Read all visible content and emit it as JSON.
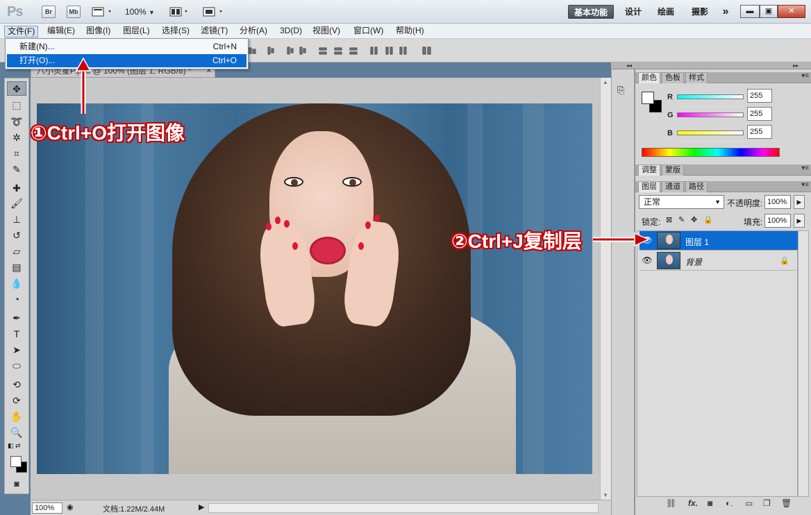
{
  "titlebar": {
    "logo": "Ps",
    "bridge": "Br",
    "minibridge": "Mb",
    "zoom": "100%",
    "workspaces": [
      "基本功能",
      "设计",
      "绘画",
      "摄影"
    ],
    "more": "»"
  },
  "menubar": {
    "items": [
      "文件(F)",
      "编辑(E)",
      "图像(I)",
      "图层(L)",
      "选择(S)",
      "滤镜(T)",
      "分析(A)",
      "3D(D)",
      "视图(V)",
      "窗口(W)",
      "帮助(H)"
    ]
  },
  "file_menu": {
    "items": [
      {
        "label": "新建(N)...",
        "shortcut": "Ctrl+N"
      },
      {
        "label": "打开(O)...",
        "shortcut": "Ctrl+O"
      }
    ]
  },
  "document": {
    "tab_title": "八小灵星P.psd @ 100% (图层 1, RGB/8) *"
  },
  "statusbar": {
    "zoom": "100%",
    "doc_info": "文档:1.22M/2.44M"
  },
  "color_panel": {
    "tabs": [
      "颜色",
      "色板",
      "样式"
    ],
    "channels": [
      {
        "label": "R",
        "value": "255"
      },
      {
        "label": "G",
        "value": "255"
      },
      {
        "label": "B",
        "value": "255"
      }
    ]
  },
  "adjust_panel": {
    "tabs": [
      "调整",
      "蒙版"
    ]
  },
  "layers_panel": {
    "tabs": [
      "图层",
      "通道",
      "路径"
    ],
    "blend_mode": "正常",
    "opacity_label": "不透明度:",
    "opacity": "100%",
    "lock_label": "锁定:",
    "fill_label": "填充:",
    "fill": "100%",
    "layers": [
      {
        "name": "图层 1",
        "selected": true
      },
      {
        "name": "背景",
        "selected": false
      }
    ]
  },
  "annotations": {
    "step1": "①Ctrl+O打开图像",
    "step2": "②Ctrl+J复制层"
  },
  "colors": {
    "accent": "#0c6bd1",
    "annotation": "#cc0000"
  }
}
